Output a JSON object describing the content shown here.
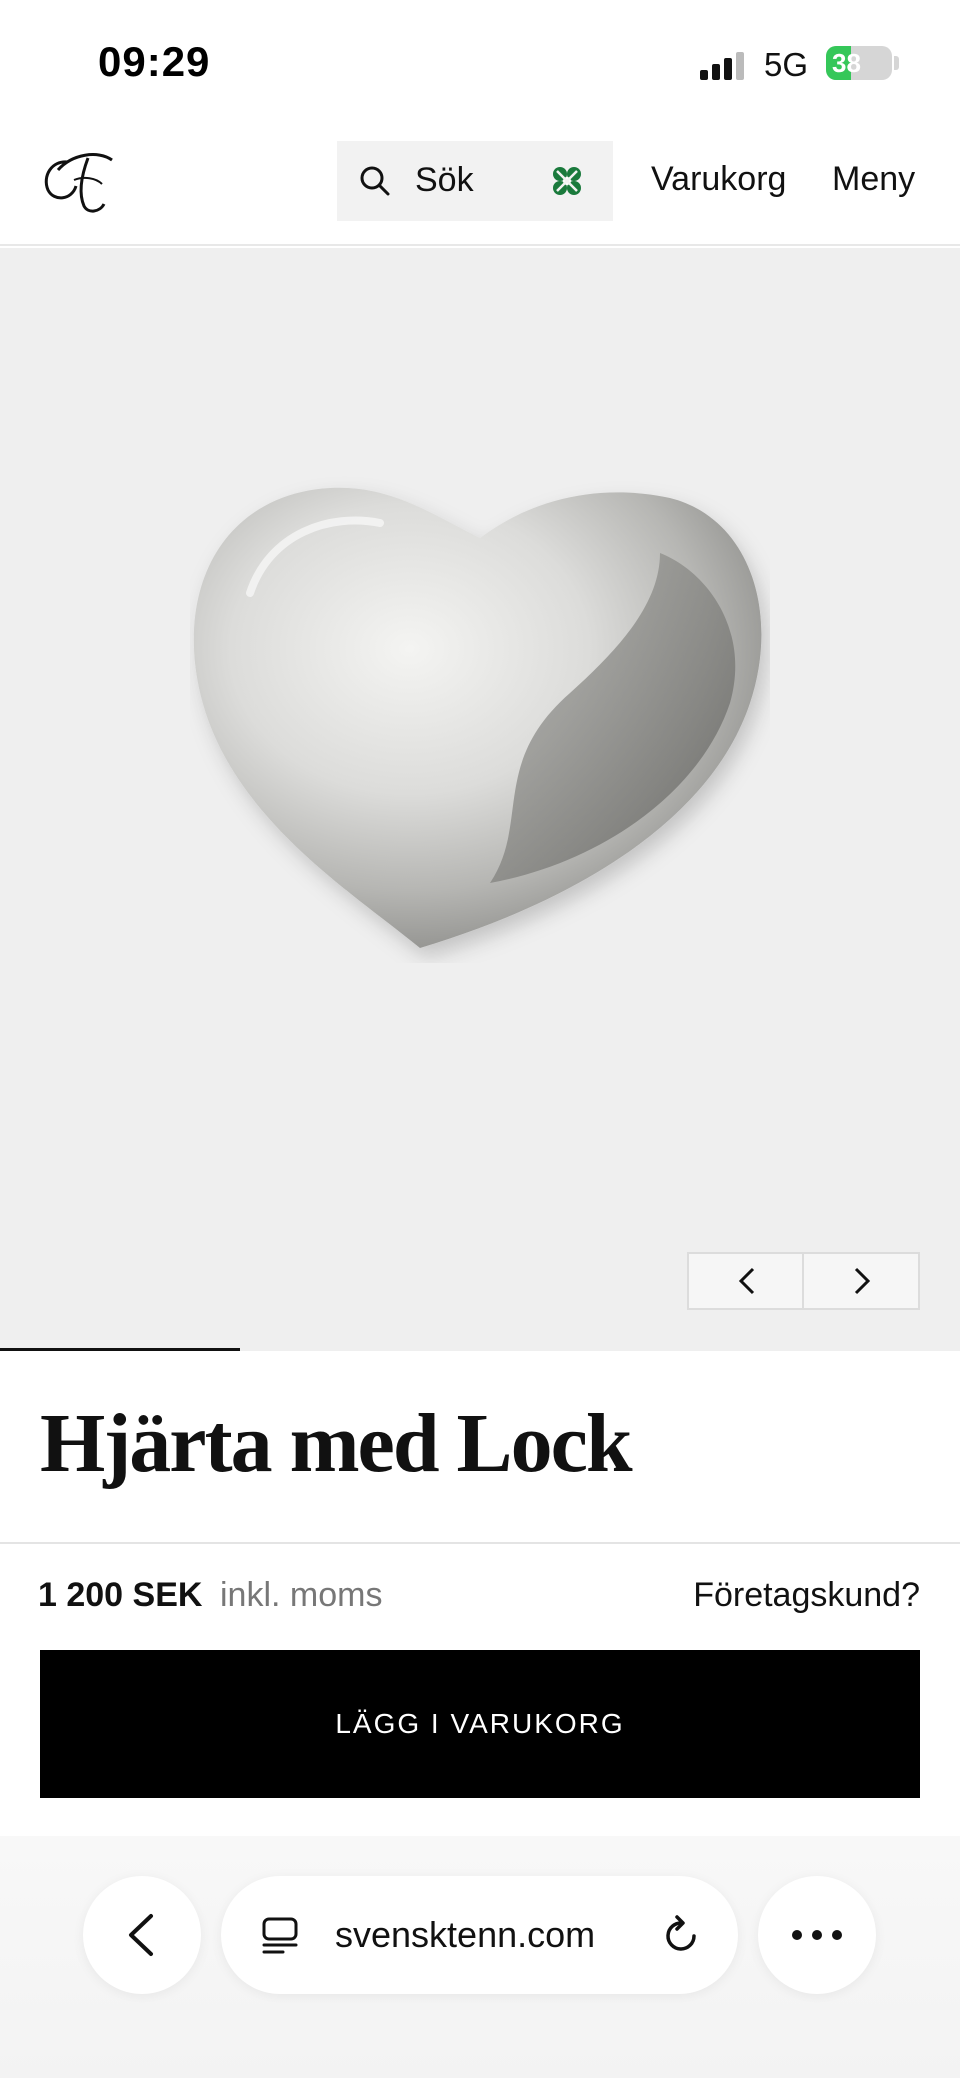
{
  "status_bar": {
    "time": "09:29",
    "network": "5G",
    "battery_percent": 38,
    "battery_label": "38"
  },
  "header": {
    "logo_icon": "monogram-logo-icon",
    "search_label": "Sök",
    "search_icon": "search-icon",
    "clover_icon": "four-leaf-clover-icon",
    "cart_label": "Varukorg",
    "menu_label": "Meny"
  },
  "gallery": {
    "prev_icon": "chevron-left-icon",
    "next_icon": "chevron-right-icon",
    "progress_fraction": 0.25
  },
  "product": {
    "title": "Hjärta med Lock",
    "price": "1 200 SEK",
    "price_note": "inkl. moms",
    "business_link": "Företagskund?",
    "add_to_cart_label": "LÄGG I VARUKORG"
  },
  "browser": {
    "url": "svensktenn.com",
    "back_icon": "chevron-left-icon",
    "reader_icon": "reader-mode-icon",
    "reload_icon": "reload-icon",
    "more_icon": "more-dots-icon"
  },
  "colors": {
    "accent_clover": "#1a7a3c",
    "button_bg": "#000000",
    "image_bg": "#efefef",
    "battery_fill": "#35c759"
  }
}
